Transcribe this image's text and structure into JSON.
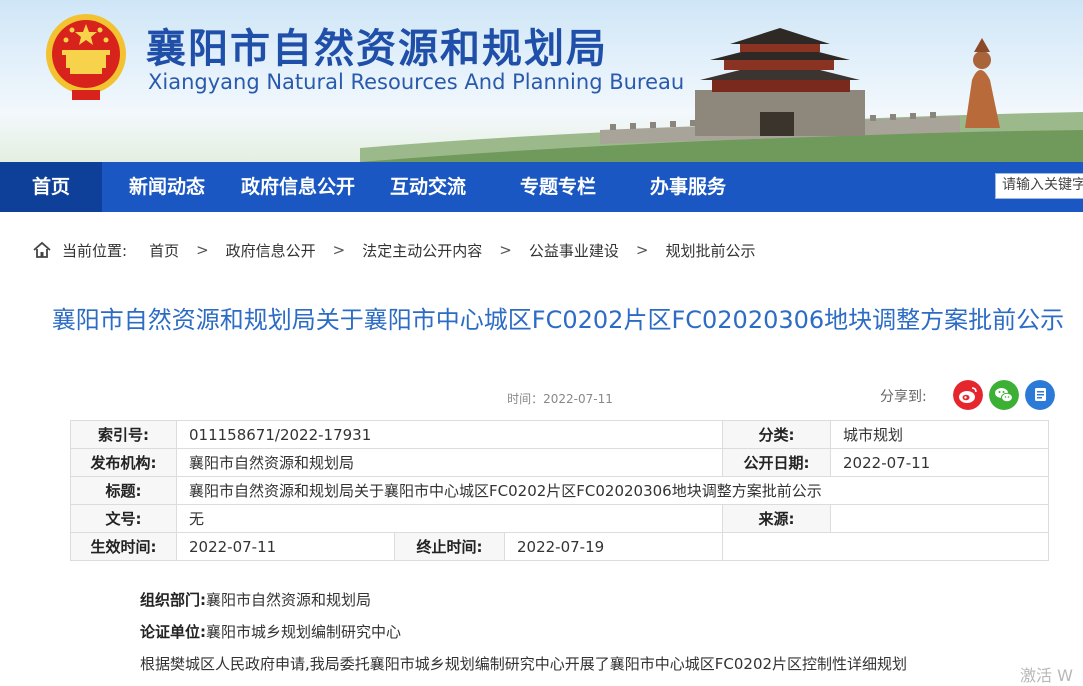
{
  "header": {
    "title": "襄阳市自然资源和规划局",
    "subtitle": "Xiangyang Natural Resources And Planning Bureau"
  },
  "nav": {
    "items": [
      {
        "label": "首页"
      },
      {
        "label": "新闻动态"
      },
      {
        "label": "政府信息公开"
      },
      {
        "label": "互动交流"
      },
      {
        "label": "专题专栏"
      },
      {
        "label": "办事服务"
      }
    ],
    "search_placeholder": "请输入关键字"
  },
  "breadcrumb": {
    "prefix": "当前位置:",
    "items": [
      "首页",
      "政府信息公开",
      "法定主动公开内容",
      "公益事业建设",
      "规划批前公示"
    ],
    "separator": ">"
  },
  "article": {
    "title": "襄阳市自然资源和规划局关于襄阳市中心城区FC0202片区FC02020306地块调整方案批前公示",
    "time": "时间：2022-07-11",
    "share_label": "分享到:"
  },
  "meta_table": {
    "index_label": "索引号:",
    "index_value": "011158671/2022-17931",
    "category_label": "分类:",
    "category_value": "城市规划",
    "publisher_label": "发布机构:",
    "publisher_value": "襄阳市自然资源和规划局",
    "pubdate_label": "公开日期:",
    "pubdate_value": "2022-07-11",
    "title_label": "标题:",
    "title_value": "襄阳市自然资源和规划局关于襄阳市中心城区FC0202片区FC02020306地块调整方案批前公示",
    "docno_label": "文号:",
    "docno_value": "无",
    "source_label": "来源:",
    "source_value": "",
    "effective_label": "生效时间:",
    "effective_value": "2022-07-11",
    "end_label": "终止时间:",
    "end_value": "2022-07-19"
  },
  "body": {
    "org_label": "组织部门:",
    "org_value": "襄阳市自然资源和规划局",
    "unit_label": "论证单位:",
    "unit_value": "襄阳市城乡规划编制研究中心",
    "paragraph": "根据樊城区人民政府申请,我局委托襄阳市城乡规划编制研究中心开展了襄阳市中心城区FC0202片区控制性详细规划"
  },
  "watermark": "激活 W",
  "colors": {
    "nav_bg": "#1a57c2",
    "nav_active": "#0e3f99",
    "title_blue": "#2d6cc4",
    "weibo": "#e6262d",
    "wechat": "#3cb034",
    "share_blue": "#2b7ad8"
  },
  "icons": [
    "national-emblem-icon",
    "home-icon",
    "weibo-icon",
    "wechat-icon",
    "share-icon"
  ]
}
